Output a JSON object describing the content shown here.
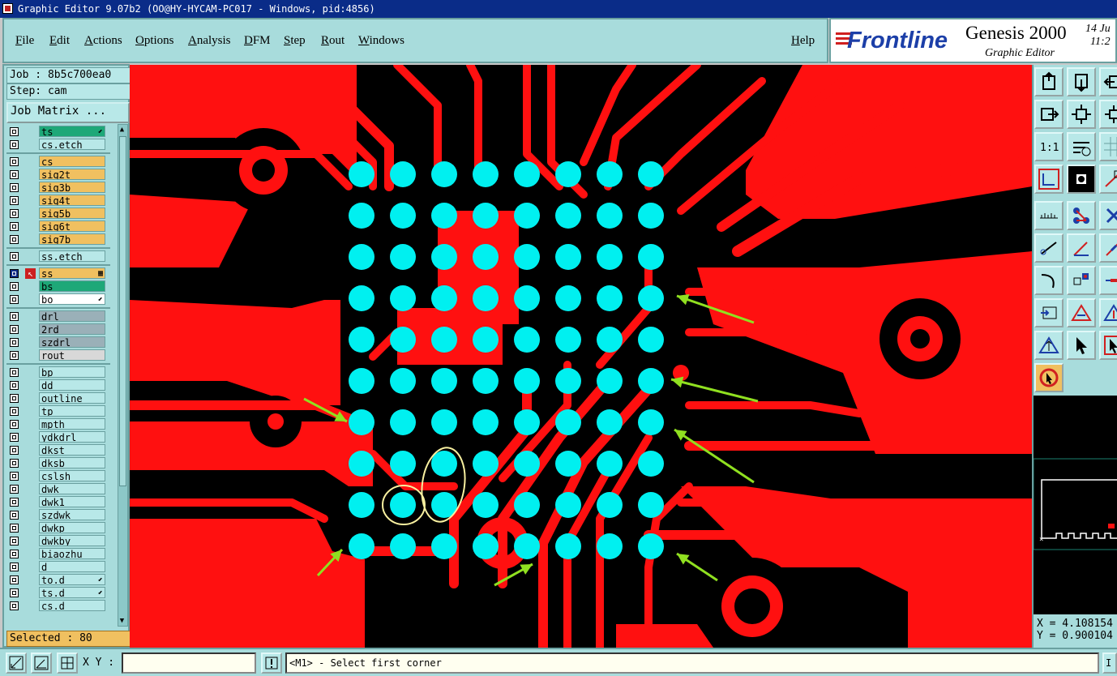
{
  "window": {
    "title": "Graphic Editor 9.07b2 (OO@HY-HYCAM-PC017 - Windows, pid:4856)"
  },
  "menu": {
    "items": [
      "File",
      "Edit",
      "Actions",
      "Options",
      "Analysis",
      "DFM",
      "Step",
      "Rout",
      "Windows"
    ],
    "help": "Help"
  },
  "banner": {
    "logo": "Frontline",
    "product": "Genesis 2000",
    "subtitle": "Graphic Editor",
    "date_line1": "14 Ju",
    "date_line2": "11:2"
  },
  "job": {
    "job_label": "Job : 8b5c700ea0",
    "step_label": "Step: cam",
    "matrix_button": "Job Matrix ..."
  },
  "layers": [
    {
      "name": "ts",
      "color": "#1ea878",
      "flag": "⬋",
      "group": 0
    },
    {
      "name": "cs.etch",
      "color": "#b8e8e8",
      "flag": "",
      "group": 0
    },
    {
      "name": "cs",
      "color": "#f0c060",
      "flag": "",
      "group": 1
    },
    {
      "name": "sig2t",
      "color": "#f0c060",
      "flag": "",
      "group": 1
    },
    {
      "name": "sig3b",
      "color": "#f0c060",
      "flag": "",
      "group": 1
    },
    {
      "name": "sig4t",
      "color": "#f0c060",
      "flag": "",
      "group": 1
    },
    {
      "name": "sig5b",
      "color": "#f0c060",
      "flag": "",
      "group": 1
    },
    {
      "name": "sig6t",
      "color": "#f0c060",
      "flag": "",
      "group": 1
    },
    {
      "name": "sig7b",
      "color": "#f0c060",
      "flag": "",
      "group": 1
    },
    {
      "name": "ss.etch",
      "color": "#b8e8e8",
      "flag": "",
      "group": 2
    },
    {
      "name": "ss",
      "color": "#f0c060",
      "flag": "▦",
      "group": 3,
      "active": true
    },
    {
      "name": "bs",
      "color": "#1ea878",
      "flag": "",
      "group": 3
    },
    {
      "name": "bo",
      "color": "#ffffff",
      "flag": "⬋",
      "group": 3
    },
    {
      "name": "drl",
      "color": "#9ab0b8",
      "flag": "",
      "group": 4
    },
    {
      "name": "2rd",
      "color": "#9ab0b8",
      "flag": "",
      "group": 4
    },
    {
      "name": "szdrl",
      "color": "#9ab0b8",
      "flag": "",
      "group": 4
    },
    {
      "name": "rout",
      "color": "#d8d8d8",
      "flag": "",
      "group": 4
    },
    {
      "name": "bp",
      "color": "#b8e8e8",
      "flag": "",
      "group": 5
    },
    {
      "name": "dd",
      "color": "#b8e8e8",
      "flag": "",
      "group": 5
    },
    {
      "name": "outline",
      "color": "#b8e8e8",
      "flag": "",
      "group": 5
    },
    {
      "name": "tp",
      "color": "#b8e8e8",
      "flag": "",
      "group": 5
    },
    {
      "name": "mpth",
      "color": "#b8e8e8",
      "flag": "",
      "group": 5
    },
    {
      "name": "ydkdrl",
      "color": "#b8e8e8",
      "flag": "",
      "group": 5
    },
    {
      "name": "dkst",
      "color": "#b8e8e8",
      "flag": "",
      "group": 5
    },
    {
      "name": "dksb",
      "color": "#b8e8e8",
      "flag": "",
      "group": 5
    },
    {
      "name": "cslsh",
      "color": "#b8e8e8",
      "flag": "",
      "group": 5
    },
    {
      "name": "dwk",
      "color": "#b8e8e8",
      "flag": "",
      "group": 5
    },
    {
      "name": "dwk1",
      "color": "#b8e8e8",
      "flag": "",
      "group": 5
    },
    {
      "name": "szdwk",
      "color": "#b8e8e8",
      "flag": "",
      "group": 5
    },
    {
      "name": "dwkp",
      "color": "#b8e8e8",
      "flag": "",
      "group": 5
    },
    {
      "name": "dwkby",
      "color": "#b8e8e8",
      "flag": "",
      "group": 5
    },
    {
      "name": "biaozhu",
      "color": "#b8e8e8",
      "flag": "",
      "group": 5
    },
    {
      "name": "d",
      "color": "#b8e8e8",
      "flag": "",
      "group": 5
    },
    {
      "name": "to.d",
      "color": "#b8e8e8",
      "flag": "⬋",
      "group": 5
    },
    {
      "name": "ts.d",
      "color": "#b8e8e8",
      "flag": "⬋",
      "group": 5
    },
    {
      "name": "cs.d",
      "color": "#b8e8e8",
      "flag": "",
      "group": 5
    }
  ],
  "status": {
    "selected": "Selected : 80",
    "xy_label": "X Y :",
    "xy_value": "",
    "message": "<M1> - Select first corner",
    "coord_x": "X = 4.108154",
    "coord_y": "Y = 0.900104"
  },
  "colors": {
    "copper": "#ff1010",
    "pad": "#00f0f0",
    "background": "#000000",
    "panel": "#a8dcdc",
    "arrow": "#90e020",
    "highlight": "#f8f0a0"
  },
  "icons": {
    "tools": [
      "home-icon",
      "pan-down-icon",
      "pan-left-icon",
      "pan-right-icon",
      "zoom-fit-icon",
      "zoom-center-icon",
      "scale-icon",
      "measure-icon",
      "grid-icon",
      "net-icon",
      "snap-icon",
      "vertex-icon",
      "ruler-icon",
      "connect-icon",
      "cross-icon",
      "hand-icon",
      "line-icon",
      "draw-line-icon",
      "stretch-icon",
      "select-point-icon",
      "edit-icon",
      "split-icon",
      "angle-icon",
      "triangle-icon",
      "tri-arrow-icon",
      "arrow-select-icon",
      "arrow-box-icon",
      "stop-icon"
    ]
  }
}
